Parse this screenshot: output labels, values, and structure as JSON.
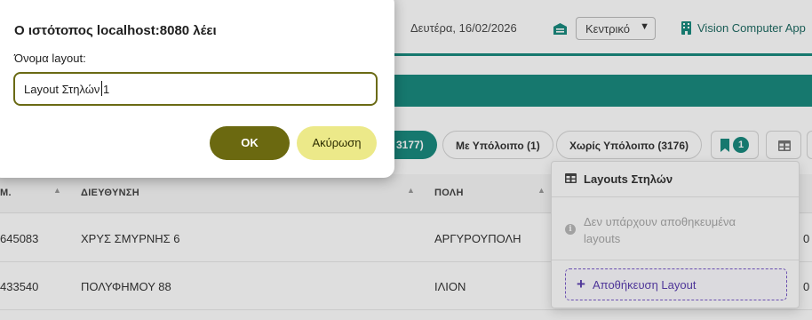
{
  "topbar": {
    "date": "Δευτέρα, 16/02/2026",
    "branch_select_value": "Κεντρικό",
    "company_name": "Vision Computer App"
  },
  "filters": {
    "active_partial": "3177)",
    "with_balance": "Με Υπόλοιπο (1)",
    "without_balance": "Χωρίς Υπόλοιπο (3176)",
    "bookmark_badge": "1"
  },
  "table": {
    "headers": [
      "Μ.",
      "ΔΙΕΥΘΥΝΣΗ",
      "ΠΟΛΗ"
    ],
    "rows": [
      {
        "id": "645083",
        "address": "ΧΡΥΣ ΣΜΥΡΝΗΣ 6",
        "city": "ΑΡΓΥΡΟΥΠΟΛΗ",
        "edge": "0"
      },
      {
        "id": "433540",
        "address": "ΠΟΛΥΦΗΜΟΥ 88",
        "city": "ΙΛΙΟΝ",
        "edge": "0"
      }
    ]
  },
  "layouts_menu": {
    "title": "Layouts Στηλών",
    "empty_message": "Δεν υπάρχουν αποθηκευμένα layouts",
    "save_button": "Αποθήκευση Layout"
  },
  "dialog": {
    "title": "Ο ιστότοπος localhost:8080 λέει",
    "prompt_label": "Όνομα layout:",
    "input_value": "Layout Στηλών 1",
    "ok_label": "OK",
    "cancel_label": "Ακύρωση"
  },
  "colors": {
    "teal": "#1a8a7f",
    "ok_button": "#6b6910",
    "cancel_button": "#ece989",
    "save_layout_accent": "#5b3fb0"
  }
}
